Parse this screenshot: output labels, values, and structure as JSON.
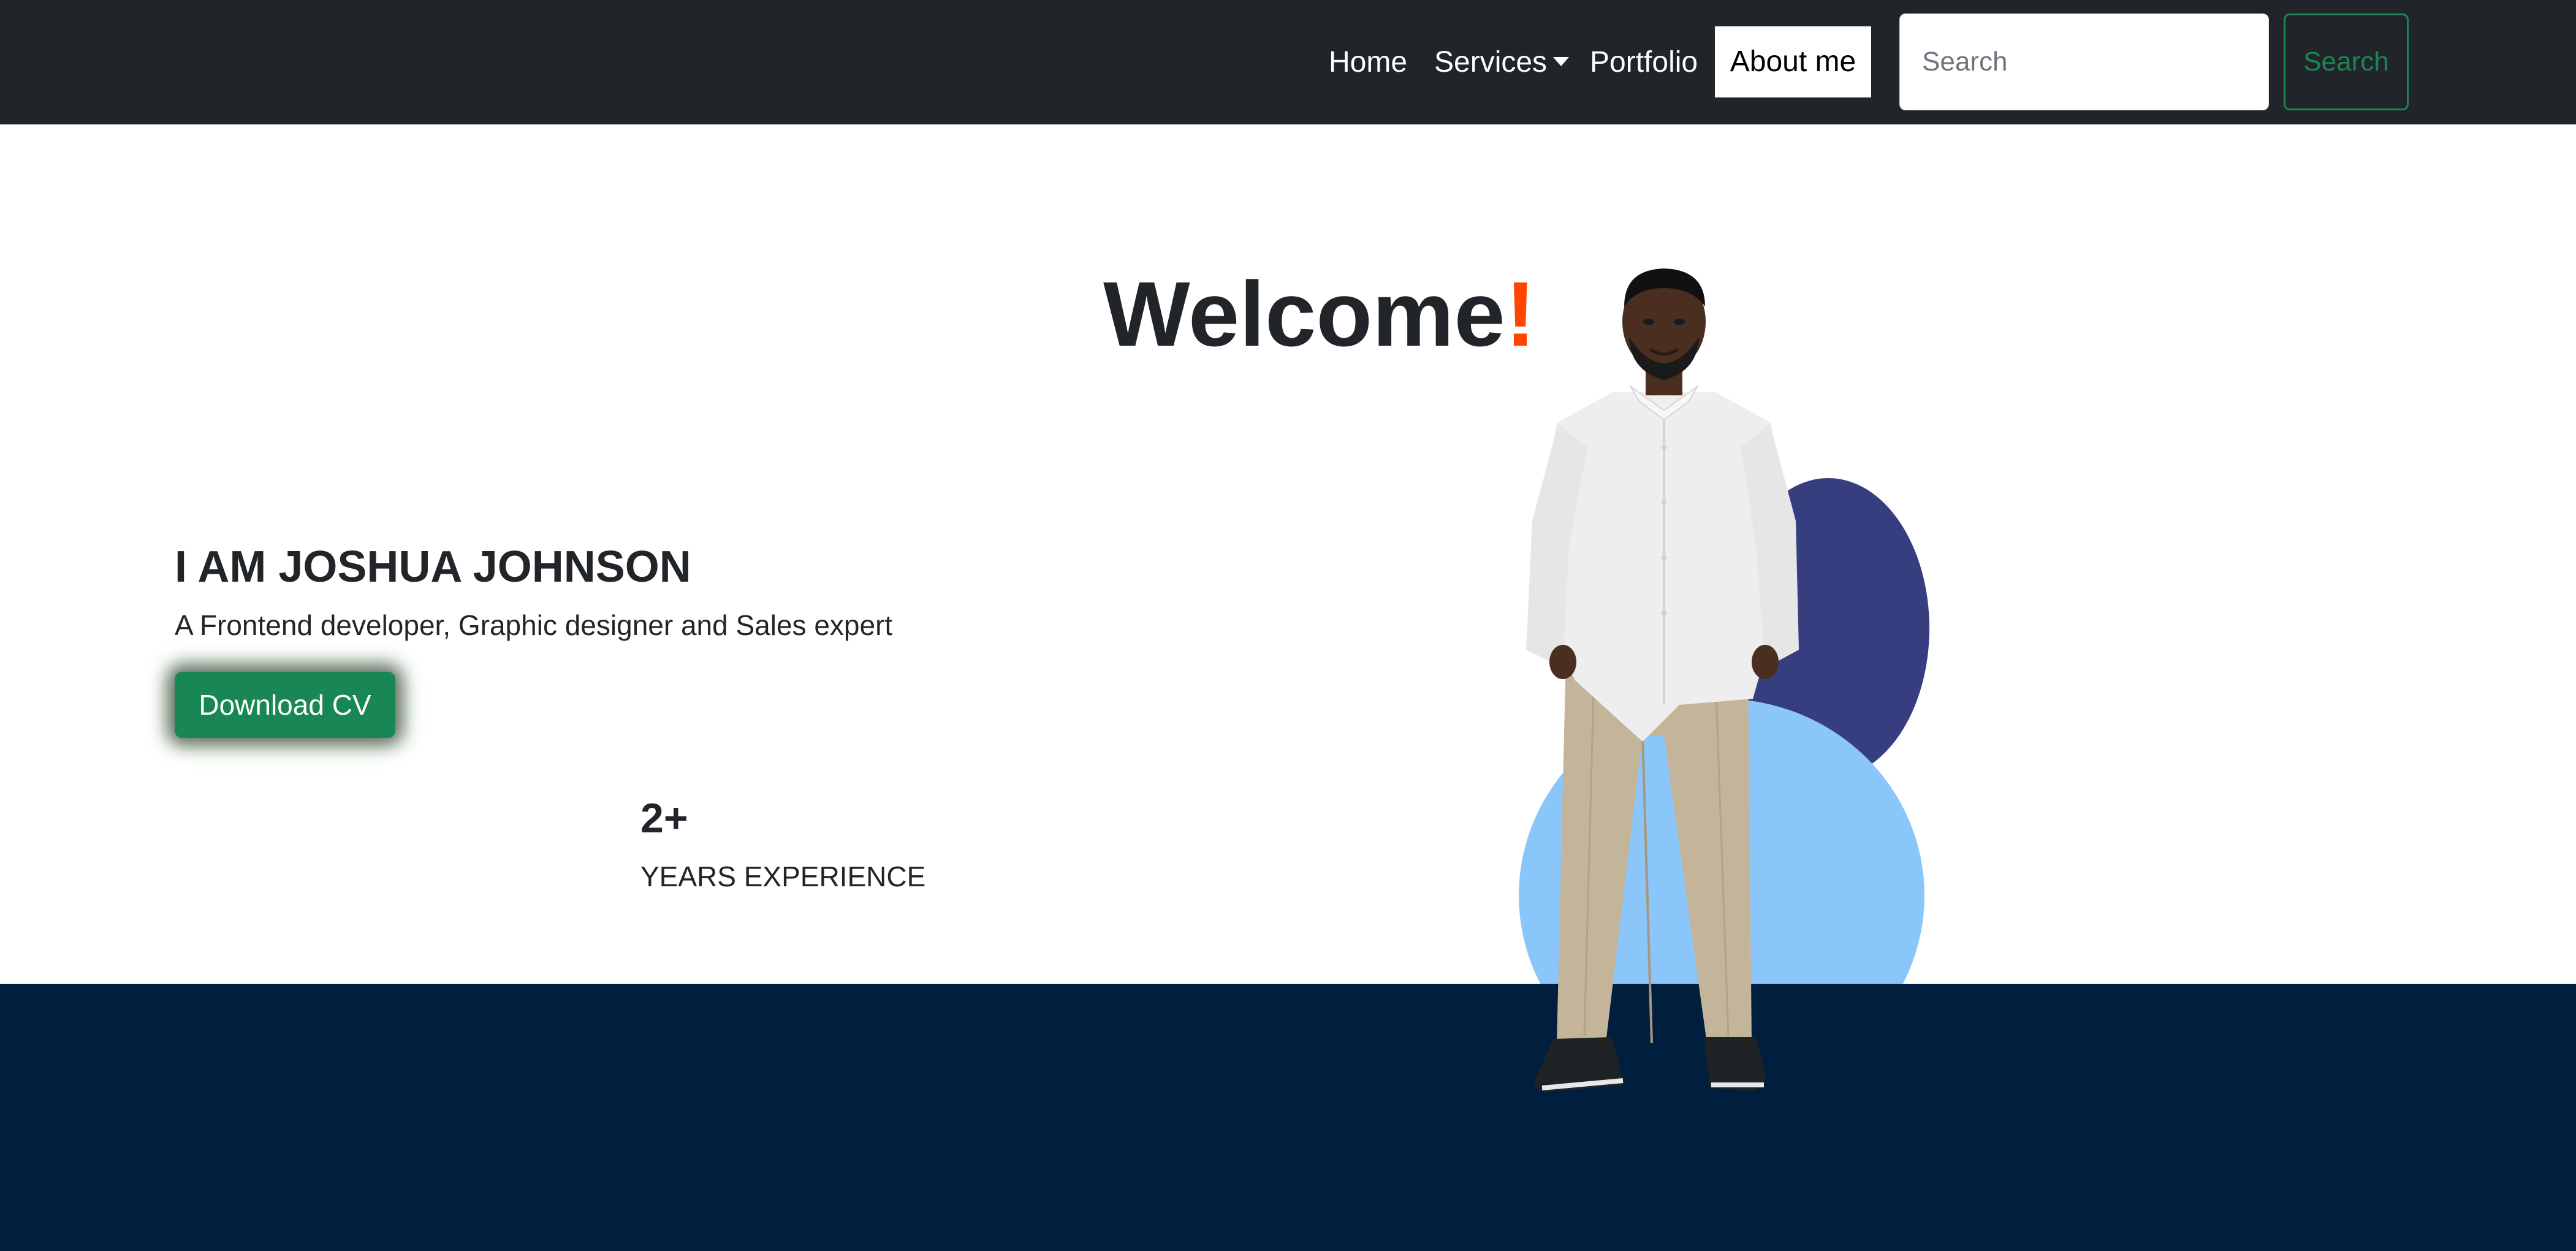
{
  "navbar": {
    "links": [
      {
        "label": "Home"
      },
      {
        "label": "Services"
      },
      {
        "label": "Portfolio"
      },
      {
        "label": "About me"
      }
    ],
    "search": {
      "placeholder": "Search",
      "value": "",
      "button_label": "Search"
    }
  },
  "hero": {
    "welcome_text": "Welcome",
    "welcome_punct": "!",
    "name": "I AM JOSHUA JOHNSON",
    "subtitle": "A Frontend developer, Graphic designer and Sales expert",
    "cv_button_label": "Download CV",
    "stat_number": "2+",
    "stat_label": "YEARS EXPERIENCE"
  },
  "colors": {
    "navbar_bg": "#212529",
    "accent_green": "#198754",
    "exclamation": "#ff4500",
    "circle_dark": "#363e7f",
    "circle_light": "#8bc6fa",
    "footer_bg": "#001f3f"
  }
}
